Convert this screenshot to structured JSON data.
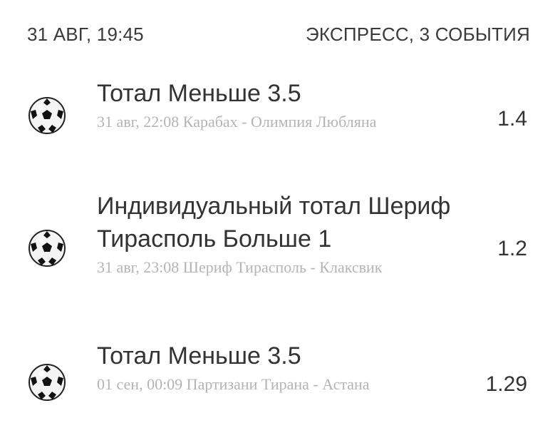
{
  "header": {
    "datetime": "31 АВГ, 19:45",
    "bet_type": "ЭКСПРЕСС, 3 СОБЫТИЯ"
  },
  "events": [
    {
      "icon": "soccer-ball-icon",
      "title": "Тотал Меньше 3.5",
      "subtitle": "31 авг, 22:08 Карабах - Олимпия Любляна",
      "odds": "1.4"
    },
    {
      "icon": "soccer-ball-icon",
      "title": "Индивидуальный тотал Шериф Тирасполь Больше 1",
      "subtitle": "31 авг, 23:08 Шериф Тирасполь - Клаксвик",
      "odds": "1.2"
    },
    {
      "icon": "soccer-ball-icon",
      "title": "Тотал Меньше 3.5",
      "subtitle": "01 сен, 00:09 Партизани Тирана - Астана",
      "odds": "1.29"
    }
  ]
}
